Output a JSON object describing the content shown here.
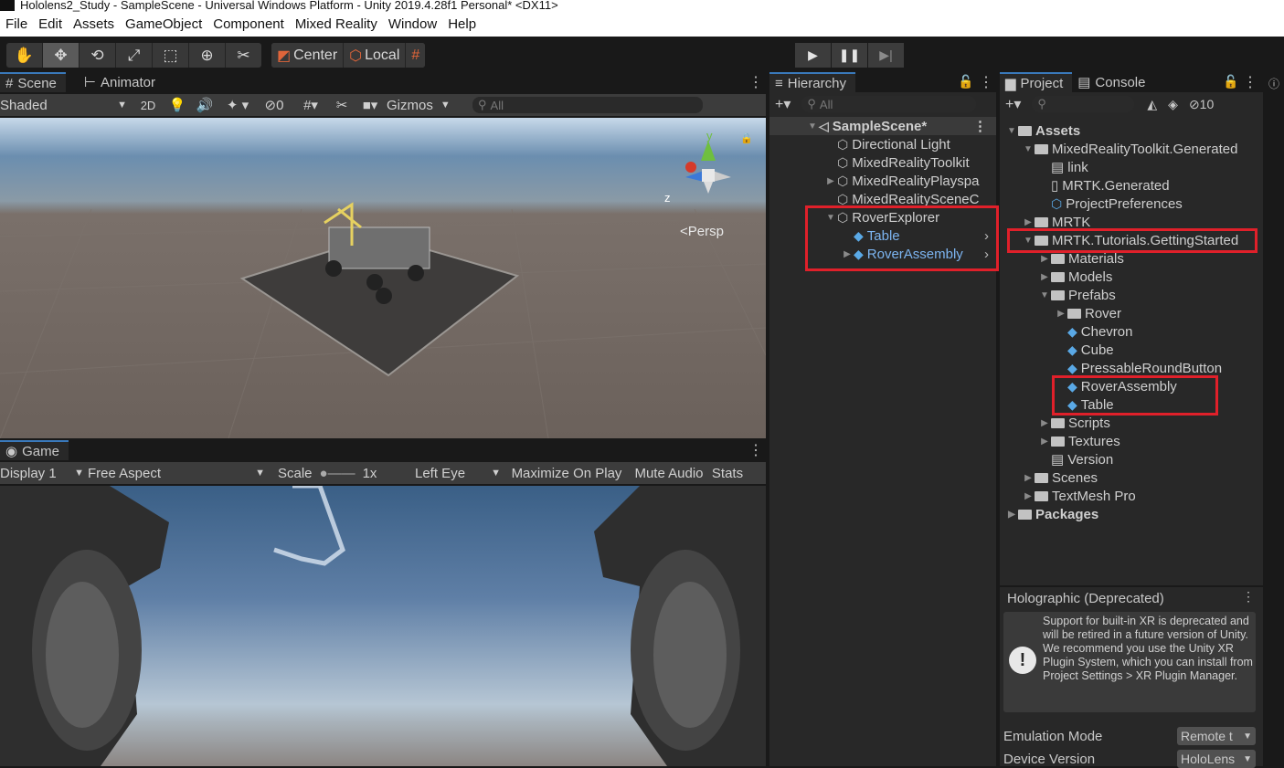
{
  "window": {
    "title": "Hololens2_Study - SampleScene - Universal Windows Platform - Unity 2019.4.28f1 Personal* <DX11>"
  },
  "menu": [
    "File",
    "Edit",
    "Assets",
    "GameObject",
    "Component",
    "Mixed Reality",
    "Window",
    "Help"
  ],
  "toolbar": {
    "center_label": "Center",
    "local_label": "Local"
  },
  "scene_panel": {
    "tabs": [
      "Scene",
      "Animator"
    ],
    "shading": "Shaded",
    "mode_2d": "2D",
    "hidden_count": "0",
    "gizmos_label": "Gizmos",
    "search_placeholder": "All",
    "persp_label": "Persp",
    "axis_y": "y",
    "axis_z": "z"
  },
  "game_panel": {
    "tab": "Game",
    "display": "Display 1",
    "aspect": "Free Aspect",
    "scale_label": "Scale",
    "scale_value": "1x",
    "eye": "Left Eye",
    "maximize": "Maximize On Play",
    "mute": "Mute Audio",
    "stats": "Stats"
  },
  "hierarchy": {
    "tab": "Hierarchy",
    "search_placeholder": "All",
    "scene_name": "SampleScene*",
    "items": [
      {
        "label": "Directional Light"
      },
      {
        "label": "MixedRealityToolkit"
      },
      {
        "label": "MixedRealityPlayspa"
      },
      {
        "label": "MixedRealitySceneC"
      },
      {
        "label": "RoverExplorer"
      },
      {
        "label": "Table"
      },
      {
        "label": "RoverAssembly"
      }
    ]
  },
  "project": {
    "tabs": [
      "Project",
      "Console"
    ],
    "hidden_count": "10",
    "items": [
      {
        "label": "Assets"
      },
      {
        "label": "MixedRealityToolkit.Generated"
      },
      {
        "label": "link"
      },
      {
        "label": "MRTK.Generated"
      },
      {
        "label": "ProjectPreferences"
      },
      {
        "label": "MRTK"
      },
      {
        "label": "MRTK.Tutorials.GettingStarted"
      },
      {
        "label": "Materials"
      },
      {
        "label": "Models"
      },
      {
        "label": "Prefabs"
      },
      {
        "label": "Rover"
      },
      {
        "label": "Chevron"
      },
      {
        "label": "Cube"
      },
      {
        "label": "PressableRoundButton"
      },
      {
        "label": "RoverAssembly"
      },
      {
        "label": "Table"
      },
      {
        "label": "Scripts"
      },
      {
        "label": "Textures"
      },
      {
        "label": "Version"
      },
      {
        "label": "Scenes"
      },
      {
        "label": "TextMesh Pro"
      },
      {
        "label": "Packages"
      }
    ]
  },
  "inspector": {
    "title": "Holographic (Deprecated)",
    "warning": "Support for built-in XR is deprecated and will be retired in a future version of Unity. We recommend you use the Unity XR Plugin System, which you can install from Project Settings > XR Plugin Manager.",
    "emulation_label": "Emulation Mode",
    "emulation_value": "Remote t",
    "device_label": "Device Version",
    "device_value": "HoloLens"
  },
  "colors": {
    "highlight_red": "#e0202a",
    "prefab_blue": "#7cb4f0",
    "accent": "#3a79bb"
  }
}
